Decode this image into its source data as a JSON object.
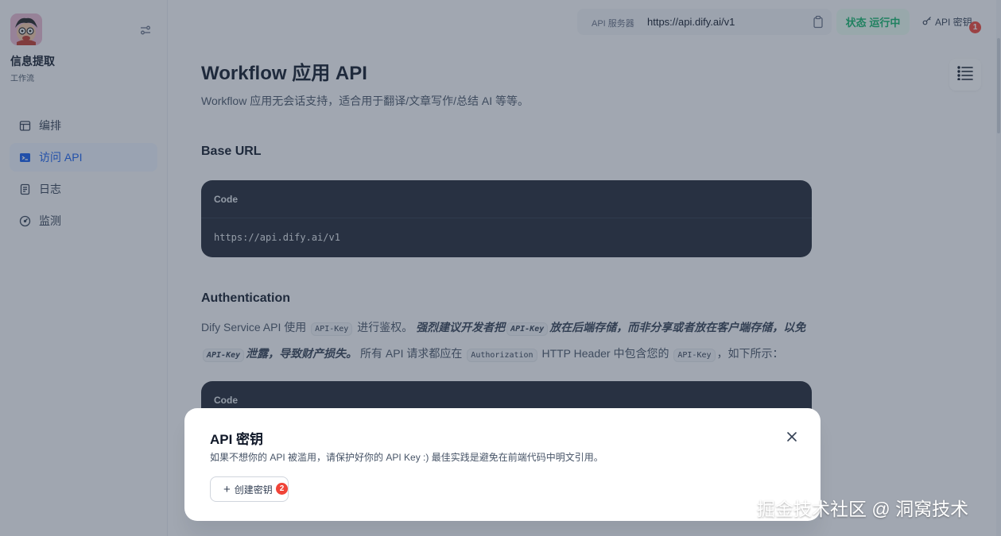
{
  "sidebar": {
    "app_name": "信息提取",
    "app_type": "工作流",
    "items": [
      {
        "label": "编排",
        "icon": "layout-icon"
      },
      {
        "label": "访问 API",
        "icon": "terminal-icon"
      },
      {
        "label": "日志",
        "icon": "file-list-icon"
      },
      {
        "label": "监测",
        "icon": "dashboard-icon"
      }
    ]
  },
  "topbar": {
    "server_label": "API 服务器",
    "server_url": "https://api.dify.ai/v1",
    "status_label": "状态",
    "status_value": "运行中",
    "api_key_label": "API 密钥",
    "api_key_badge": "1"
  },
  "doc": {
    "title": "Workflow 应用 API",
    "subtitle": "Workflow 应用无会话支持，适合用于翻译/文章写作/总结 AI 等等。",
    "base_url_heading": "Base URL",
    "code_label": "Code",
    "base_url_code": "https://api.dify.ai/v1",
    "auth_heading": "Authentication",
    "auth_text_1": "Dify Service API 使用",
    "auth_code_api_key": "API-Key",
    "auth_text_2": "进行鉴权。",
    "auth_bold_1": "强烈建议开发者把",
    "auth_bold_2": "放在后端存储，而非分享或者放在客户端存储，以免",
    "auth_bold_3": "泄露，导致财产损失。",
    "auth_text_3": "所有 API 请求都应在",
    "auth_code_authorization": "Authorization",
    "auth_text_4": "HTTP Header 中包含您的",
    "auth_text_5": "，如下所示："
  },
  "modal": {
    "title": "API 密钥",
    "description": "如果不想你的 API 被滥用，请保护好你的 API Key :) 最佳实践是避免在前端代码中明文引用。",
    "create_button": "创建密钥",
    "create_badge": "2"
  },
  "watermark": "掘金技术社区 @ 洞窝技术",
  "colors": {
    "accent": "#155eef",
    "status_green": "#12b76a",
    "badge_red": "#f04438",
    "code_bg": "#1f2633"
  }
}
